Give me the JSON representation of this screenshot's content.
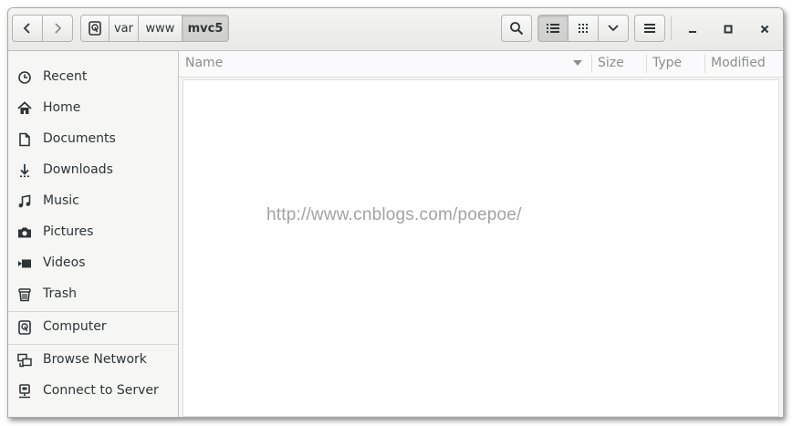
{
  "pathbar": {
    "segments": [
      "var",
      "www",
      "mvc5"
    ],
    "active": "mvc5"
  },
  "toolbar": {
    "back_icon": "chevron-left-icon",
    "forward_icon": "chevron-right-icon",
    "search_icon": "search-icon",
    "list_view_icon": "list-view-icon",
    "grid_view_icon": "grid-view-icon",
    "view_options_icon": "chevron-down-icon",
    "menu_icon": "hamburger-menu-icon"
  },
  "window_controls": {
    "minimize_icon": "minimize-icon",
    "maximize_icon": "maximize-icon",
    "close_icon": "close-icon"
  },
  "sidebar": {
    "items": [
      {
        "label": "Recent",
        "icon": "clock-icon"
      },
      {
        "label": "Home",
        "icon": "home-icon"
      },
      {
        "label": "Documents",
        "icon": "document-icon"
      },
      {
        "label": "Downloads",
        "icon": "download-icon"
      },
      {
        "label": "Music",
        "icon": "music-icon"
      },
      {
        "label": "Pictures",
        "icon": "camera-icon"
      },
      {
        "label": "Videos",
        "icon": "video-icon"
      },
      {
        "label": "Trash",
        "icon": "trash-icon"
      },
      {
        "label": "Computer",
        "icon": "drive-icon"
      },
      {
        "label": "Browse Network",
        "icon": "network-icon"
      },
      {
        "label": "Connect to Server",
        "icon": "server-icon"
      }
    ]
  },
  "columns": {
    "name": "Name",
    "size": "Size",
    "type": "Type",
    "modified": "Modified"
  },
  "watermark": "http://www.cnblogs.com/poepoe/",
  "colors": {
    "window_bg": "#f6f6f5",
    "content_bg": "#ffffff",
    "text": "#2e3436",
    "column_header_text": "#8b8e8f",
    "watermark": "#a3a3a3"
  }
}
